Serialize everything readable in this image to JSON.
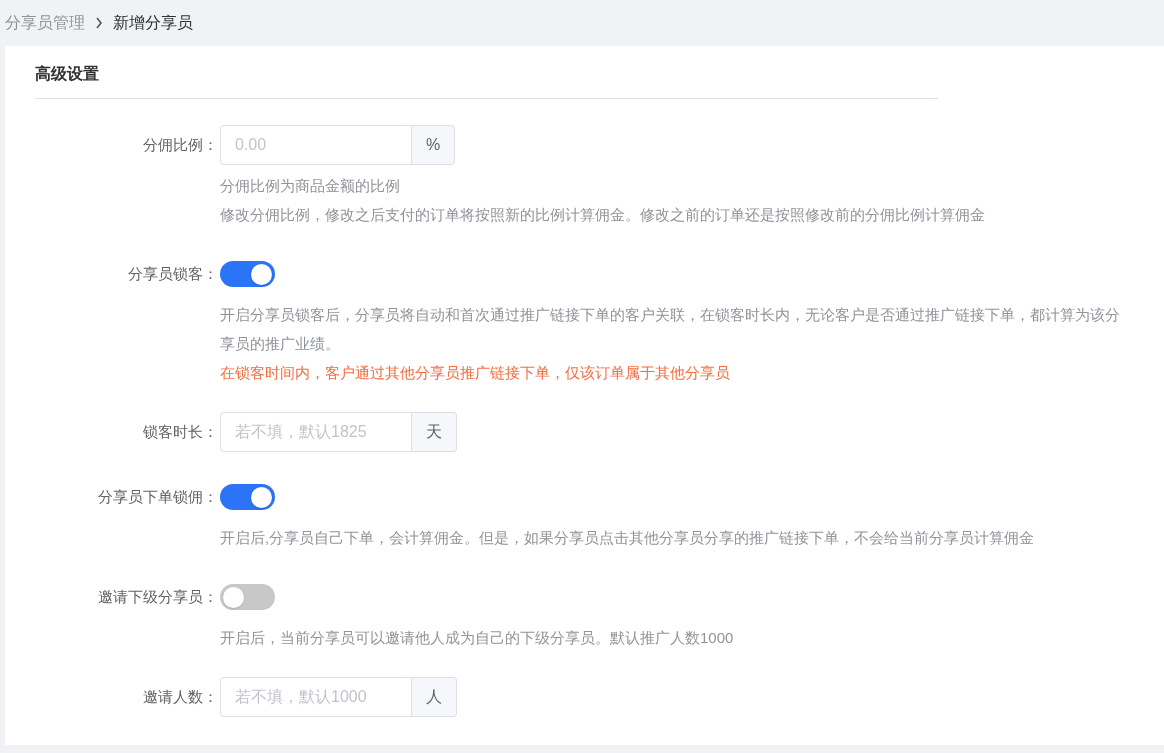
{
  "breadcrumb": [
    {
      "label": "分享员管理",
      "current": false
    },
    {
      "label": "新增分享员",
      "current": true
    }
  ],
  "section_title": "高级设置",
  "fields": [
    {
      "kind": "input",
      "label": "分佣比例：",
      "placeholder": "0.00",
      "unit": "%",
      "help": [
        {
          "kind": "note",
          "text": "分佣比例为商品金额的比例"
        },
        {
          "kind": "note",
          "text": "修改分佣比例，修改之后支付的订单将按照新的比例计算佣金。修改之前的订单还是按照修改前的分佣比例计算佣金"
        }
      ]
    },
    {
      "kind": "switch",
      "label": "分享员锁客：",
      "on": true,
      "help": [
        {
          "kind": "note",
          "text": "开启分享员锁客后，分享员将自动和首次通过推广链接下单的客户关联，在锁客时长内，无论客户是否通过推广链接下单，都计算为该分享员的推广业绩。"
        },
        {
          "kind": "warning",
          "text": "在锁客时间内，客户通过其他分享员推广链接下单，仅该订单属于其他分享员"
        }
      ]
    },
    {
      "kind": "input",
      "label": "锁客时长：",
      "placeholder": "若不填，默认1825",
      "unit": "天"
    },
    {
      "kind": "switch",
      "label": "分享员下单锁佣：",
      "on": true,
      "help": [
        {
          "kind": "note",
          "text": "开启后,分享员自己下单，会计算佣金。但是，如果分享员点击其他分享员分享的推广链接下单，不会给当前分享员计算佣金"
        }
      ]
    },
    {
      "kind": "switch",
      "label": "邀请下级分享员：",
      "on": false,
      "help": [
        {
          "kind": "note",
          "text": "开启后，当前分享员可以邀请他人成为自己的下级分享员。默认推广人数1000"
        }
      ]
    },
    {
      "kind": "input",
      "label": "邀请人数：",
      "placeholder": "若不填，默认1000",
      "unit": "人"
    }
  ]
}
